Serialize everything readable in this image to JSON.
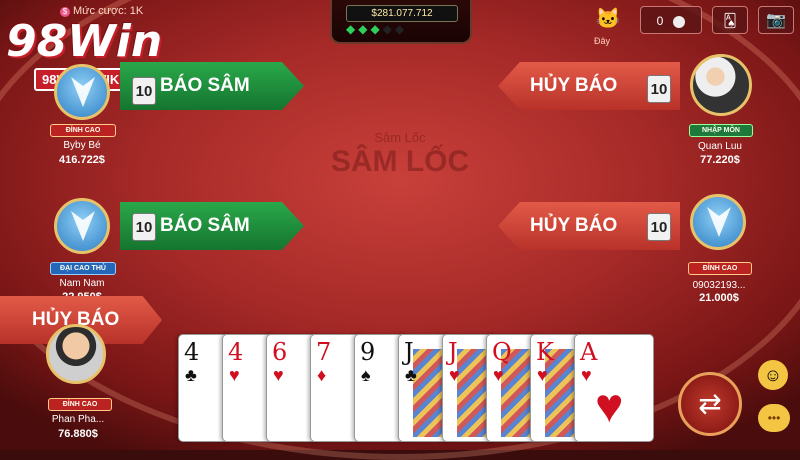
{
  "top": {
    "bet_label": "Mức cược: 1K",
    "pot_amount": "$281.077.712",
    "gems_filled": "◆◆◆",
    "gems_empty": "◆◆",
    "counter_value": "0",
    "bag_label": "Đây"
  },
  "brand": {
    "logo": "98Win",
    "site": "98WINS.WIKI"
  },
  "watermark": {
    "line1": "Sâm Lốc",
    "line2": "SÂM LỐC"
  },
  "players": [
    {
      "name": "Byby Bé",
      "money": "416.722$",
      "rank": "ĐỈNH CAO",
      "cards": "10",
      "action": "BÁO SÂM"
    },
    {
      "name": "Nam Nam",
      "money": "22.950$",
      "rank": "ĐẠI CAO THỦ",
      "cards": "10",
      "action": "BÁO SÂM"
    },
    {
      "name": "Phan Pha...",
      "money": "76.880$",
      "rank": "ĐỈNH CAO",
      "action": "HỦY BÁO"
    },
    {
      "name": "Quan Luu",
      "money": "77.220$",
      "rank": "NHẬP MÔN",
      "cards": "10",
      "action": "HỦY BÁO"
    },
    {
      "name": "09032193...",
      "money": "21.000$",
      "rank": "ĐỈNH CAO",
      "cards": "10",
      "action": "HỦY BÁO"
    }
  ],
  "hand": [
    {
      "rank": "4",
      "suit": "♣",
      "color": "black"
    },
    {
      "rank": "4",
      "suit": "♥",
      "color": "red"
    },
    {
      "rank": "6",
      "suit": "♥",
      "color": "red"
    },
    {
      "rank": "7",
      "suit": "♦",
      "color": "red"
    },
    {
      "rank": "9",
      "suit": "♠",
      "color": "black"
    },
    {
      "rank": "J",
      "suit": "♣",
      "color": "black"
    },
    {
      "rank": "J",
      "suit": "♥",
      "color": "red"
    },
    {
      "rank": "Q",
      "suit": "♥",
      "color": "red"
    },
    {
      "rank": "K",
      "suit": "♥",
      "color": "red"
    },
    {
      "rank": "A",
      "suit": "♥",
      "color": "red"
    }
  ],
  "icons": {
    "swap": "swap-icon",
    "emoji": "smile-icon",
    "chat": "chat-icon",
    "camera": "camera-icon",
    "cards": "cards-icon",
    "bag": "cat-bag-icon"
  }
}
